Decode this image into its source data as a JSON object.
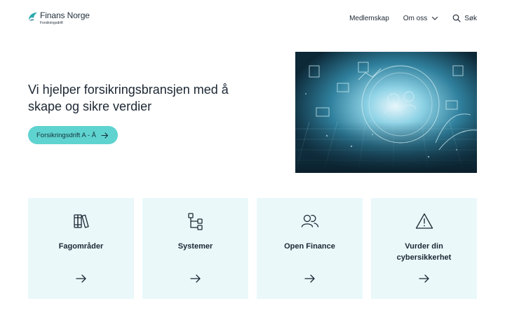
{
  "header": {
    "logo_name": "Finans Norge",
    "logo_sub": "Forsikringsdrift",
    "nav": [
      {
        "label": "Medlemskap"
      },
      {
        "label": "Om oss",
        "icon": "chevron-down-icon"
      },
      {
        "label": "Søk",
        "icon": "search-icon"
      }
    ]
  },
  "hero": {
    "title": "Vi hjelper forsikringsbransjen med å skape og sikre verdier",
    "button_label": "Forsikringsdrift A - Å",
    "image_description_icon": "digital-hand-hero-image"
  },
  "cards": [
    {
      "title": "Fagområder",
      "icon": "books-icon"
    },
    {
      "title": "Systemer",
      "icon": "hierarchy-icon"
    },
    {
      "title": "Open Finance",
      "icon": "users-icon"
    },
    {
      "title": "Vurder din cybersikkerhet",
      "icon": "warning-icon"
    }
  ],
  "colors": {
    "accent_button": "#5fd3d0",
    "card_background": "#eaf8fa",
    "text": "#1c2733",
    "logo_teal": "#2aa9b0"
  }
}
